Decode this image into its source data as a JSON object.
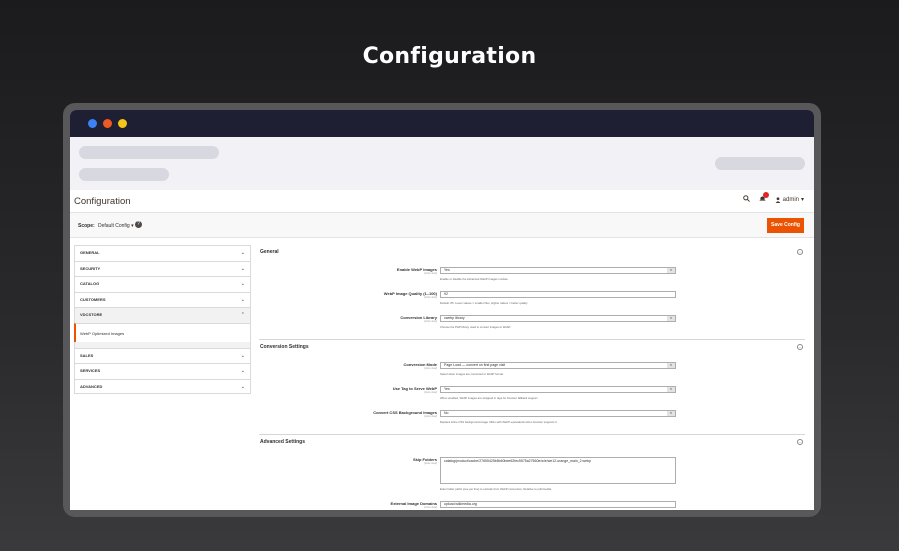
{
  "heading": "Configuration",
  "admin": {
    "title": "Configuration",
    "user": "admin",
    "scope_label": "Scope:",
    "scope_value": "Default Config",
    "help": "?",
    "save_label": "Save Config"
  },
  "sidebar": {
    "tabs": [
      {
        "label": "GENERAL"
      },
      {
        "label": "SECURITY"
      },
      {
        "label": "CATALOG"
      },
      {
        "label": "CUSTOMERS"
      },
      {
        "label": "VDCSTORE"
      }
    ],
    "subitem": "WebP Optimized Images",
    "tabs_after": [
      {
        "label": "SALES"
      },
      {
        "label": "SERVICES"
      },
      {
        "label": "ADVANCED"
      }
    ]
  },
  "sections": {
    "general": {
      "title": "General",
      "enable": {
        "label": "Enable WebP Images",
        "scope": "[store view]",
        "value": "Yes",
        "note": "Enable or disable the Advanced WebP Images module."
      },
      "quality": {
        "label": "WebP Image Quality (1–100)",
        "scope": "[store view]",
        "value": "92",
        "note": "Default: 85. Lower values = smaller files. Higher values = better quality."
      },
      "library": {
        "label": "Conversion Library",
        "scope": "[store view]",
        "value": "cwebp library",
        "note": "Choose the PHP library used to convert images to WebP."
      }
    },
    "conversion": {
      "title": "Conversion Settings",
      "mode": {
        "label": "Conversion Mode",
        "scope": "[store view]",
        "value": "Page Load — convert on first page visit",
        "note": "Select when images are converted to WebP format."
      },
      "picture": {
        "label": "Use Tag to Serve WebP",
        "scope": "[store view]",
        "value": "Yes",
        "note": "When enabled, WebP images are wrapped in tags for browser fallback support."
      },
      "css": {
        "label": "Convert CSS Background Images",
        "scope": "[store view]",
        "value": "No",
        "note": "Replace inline CSS background-image URLs with WebP equivalents when browser supports it."
      }
    },
    "advanced": {
      "title": "Advanced Settings",
      "skip": {
        "label": "Skip Folders",
        "scope": "[store view]",
        "value": "catalog/product/cache/27655425b5b60bee62fec5575a27560e/w/e/we12-orange_main_2.webp",
        "note": "Enter folder paths (one per line) to exclude from WebP conversion. Relative to pub/media/."
      },
      "external": {
        "label": "External Image Domains",
        "scope": "[store view]",
        "value": "upload.wikimedia.org"
      }
    }
  }
}
